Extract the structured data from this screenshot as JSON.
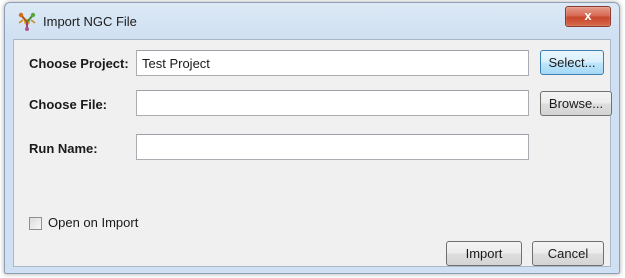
{
  "window": {
    "title": "Import NGC File",
    "icon": "ngc-app-icon",
    "close_label": "x"
  },
  "form": {
    "project": {
      "label": "Choose Project:",
      "value": "Test Project",
      "button_label": "Select..."
    },
    "file": {
      "label": "Choose File:",
      "value": "",
      "button_label": "Browse..."
    },
    "run_name": {
      "label": "Run Name:",
      "value": ""
    },
    "open_on_import": {
      "label": "Open on Import",
      "checked": false
    }
  },
  "actions": {
    "import_label": "Import",
    "cancel_label": "Cancel"
  }
}
